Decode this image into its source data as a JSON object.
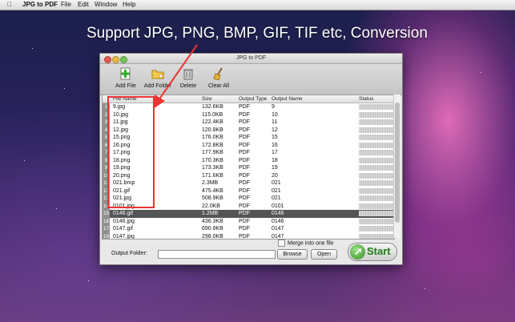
{
  "menubar": {
    "app": "JPG to PDF",
    "items": [
      "File",
      "Edit",
      "Window",
      "Help"
    ]
  },
  "banner": "Support JPG, PNG, BMP, GIF, TIF etc,  Conversion",
  "window": {
    "title": "JPG to PDF"
  },
  "toolbar": {
    "add_file": "Add File",
    "add_folder": "Add Folder",
    "delete": "Delete",
    "clear_all": "Clear All"
  },
  "table": {
    "columns": [
      "File Name",
      "Size",
      "Output Type",
      "Output Name",
      "Status"
    ],
    "rows": [
      {
        "n": "1",
        "name": "9.jpg",
        "size": "132.6KB",
        "type": "PDF",
        "out": "9"
      },
      {
        "n": "2",
        "name": "10.jpg",
        "size": "115.0KB",
        "type": "PDF",
        "out": "10"
      },
      {
        "n": "3",
        "name": "11.jpg",
        "size": "122.4KB",
        "type": "PDF",
        "out": "11"
      },
      {
        "n": "4",
        "name": "12.jpg",
        "size": "120.8KB",
        "type": "PDF",
        "out": "12"
      },
      {
        "n": "5",
        "name": "15.png",
        "size": "176.0KB",
        "type": "PDF",
        "out": "15"
      },
      {
        "n": "6",
        "name": "16.png",
        "size": "172.8KB",
        "type": "PDF",
        "out": "16"
      },
      {
        "n": "7",
        "name": "17.png",
        "size": "177.9KB",
        "type": "PDF",
        "out": "17"
      },
      {
        "n": "8",
        "name": "18.png",
        "size": "170.3KB",
        "type": "PDF",
        "out": "18"
      },
      {
        "n": "9",
        "name": "19.png",
        "size": "173.3KB",
        "type": "PDF",
        "out": "19"
      },
      {
        "n": "10",
        "name": "20.png",
        "size": "171.6KB",
        "type": "PDF",
        "out": "20"
      },
      {
        "n": "11",
        "name": "021.bmp",
        "size": "2.3MB",
        "type": "PDF",
        "out": "021"
      },
      {
        "n": "12",
        "name": "021.gif",
        "size": "475.4KB",
        "type": "PDF",
        "out": "021"
      },
      {
        "n": "13",
        "name": "021.jpg",
        "size": "508.9KB",
        "type": "PDF",
        "out": "021"
      },
      {
        "n": "14",
        "name": "0101.jpg",
        "size": "22.0KB",
        "type": "PDF",
        "out": "0101"
      },
      {
        "n": "15",
        "name": "0146.gif",
        "size": "1.2MB",
        "type": "PDF",
        "out": "0146",
        "selected": true
      },
      {
        "n": "16",
        "name": "0146.jpg",
        "size": "436.3KB",
        "type": "PDF",
        "out": "0146"
      },
      {
        "n": "17",
        "name": "0147.gif",
        "size": "690.8KB",
        "type": "PDF",
        "out": "0147"
      },
      {
        "n": "18",
        "name": "0147.jpg",
        "size": "298.0KB",
        "type": "PDF",
        "out": "0147"
      }
    ]
  },
  "merge_label": "Merge into one file",
  "output_folder": {
    "label": "Output Folder:",
    "value": ""
  },
  "buttons": {
    "browse": "Browse",
    "open": "Open",
    "start": "Start"
  },
  "colors": {
    "highlight": "#e33333",
    "selected_row": "#555555",
    "start_green": "#1d7a15"
  }
}
